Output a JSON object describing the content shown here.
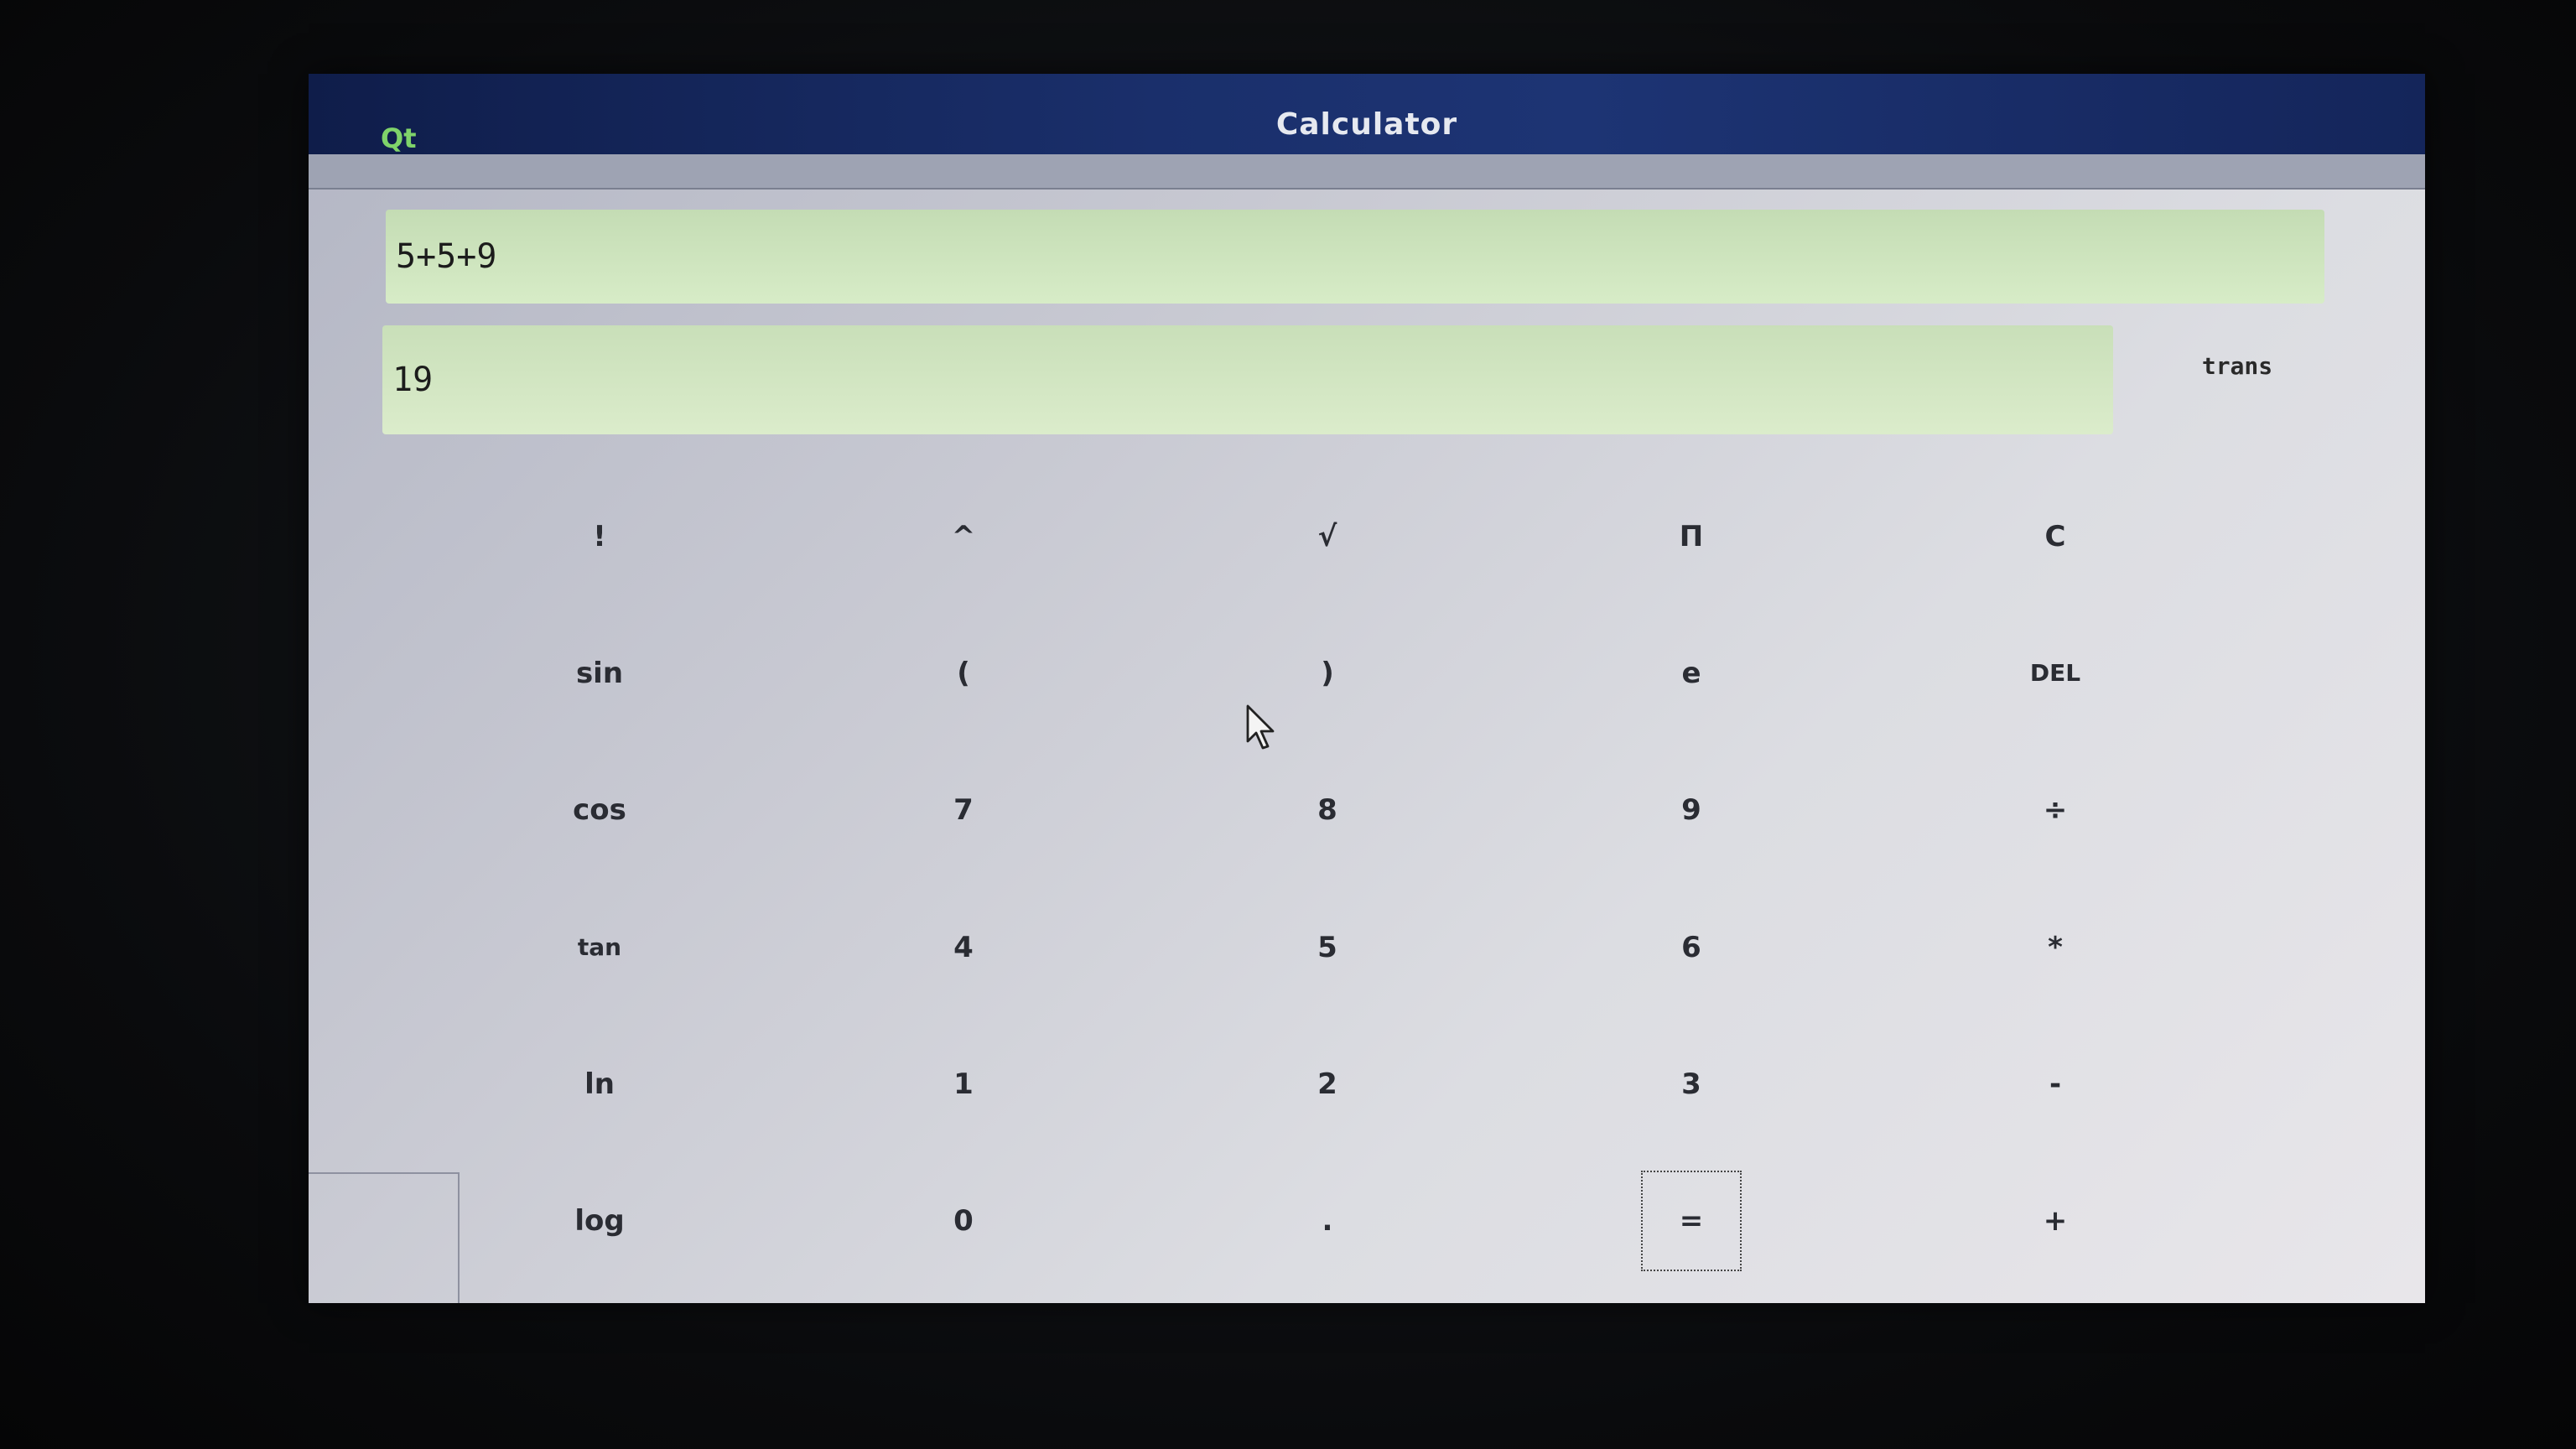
{
  "window": {
    "logo": "Qt",
    "title": "Calculator"
  },
  "display": {
    "expression": "5+5+9",
    "result": "19"
  },
  "trans_label": "trans",
  "keys": [
    [
      "!",
      "^",
      "√",
      "Π",
      "C"
    ],
    [
      "sin",
      "(",
      ")",
      "e",
      "DEL"
    ],
    [
      "cos",
      "7",
      "8",
      "9",
      "÷"
    ],
    [
      "tan",
      "4",
      "5",
      "6",
      "*"
    ],
    [
      "ln",
      "1",
      "2",
      "3",
      "-"
    ],
    [
      "log",
      "0",
      ".",
      "=",
      "+"
    ]
  ],
  "colors": {
    "titlebar": "#1a2f6b",
    "display_bg": "#d7ecc7",
    "qt_logo": "#7fd36a"
  }
}
